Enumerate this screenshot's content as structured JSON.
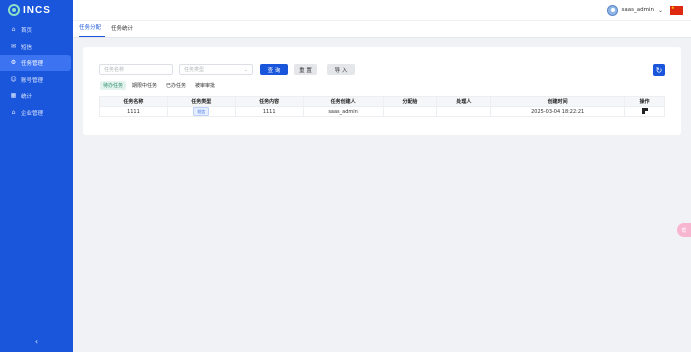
{
  "app": {
    "logo_text": "INCS"
  },
  "sidebar": {
    "items": [
      {
        "label": "首页",
        "icon": "home-icon"
      },
      {
        "label": "短信",
        "icon": "mail-icon"
      },
      {
        "label": "任务管理",
        "icon": "gear-icon",
        "active": true
      },
      {
        "label": "账号管理",
        "icon": "user-icon"
      },
      {
        "label": "统计",
        "icon": "chart-icon"
      },
      {
        "label": "企业管理",
        "icon": "building-icon"
      }
    ],
    "collapse_label": "‹"
  },
  "header": {
    "username": "saas_admin"
  },
  "tabs": [
    {
      "label": "任务分配",
      "active": true
    },
    {
      "label": "任务统计",
      "active": false
    }
  ],
  "filters": {
    "task_name_placeholder": "任务名称",
    "task_type_placeholder": "任务类型",
    "query_label": "查 询",
    "reset_label": "重 置",
    "import_label": "导 入"
  },
  "subtabs": [
    {
      "label": "待办任务",
      "active": true
    },
    {
      "label": "期限中任务",
      "active": false
    },
    {
      "label": "已办任务",
      "active": false
    },
    {
      "label": "被审审批",
      "active": false
    }
  ],
  "table": {
    "columns": [
      "任务名称",
      "任务类型",
      "任务内容",
      "任务创建人",
      "分配给",
      "处理人",
      "创建时间",
      "操作"
    ],
    "rows": [
      {
        "name": "1111",
        "type": "短信",
        "content": "1111",
        "creator": "saas_admin",
        "assignee": "",
        "handler": "",
        "created_at": "2025-03-04 18:22:21"
      }
    ]
  },
  "float_bubble": {
    "label": "帮"
  },
  "colors": {
    "primary": "#1a56db",
    "sidebar_bg": "#1a56db",
    "active_subtab": "#2a8d6e"
  }
}
